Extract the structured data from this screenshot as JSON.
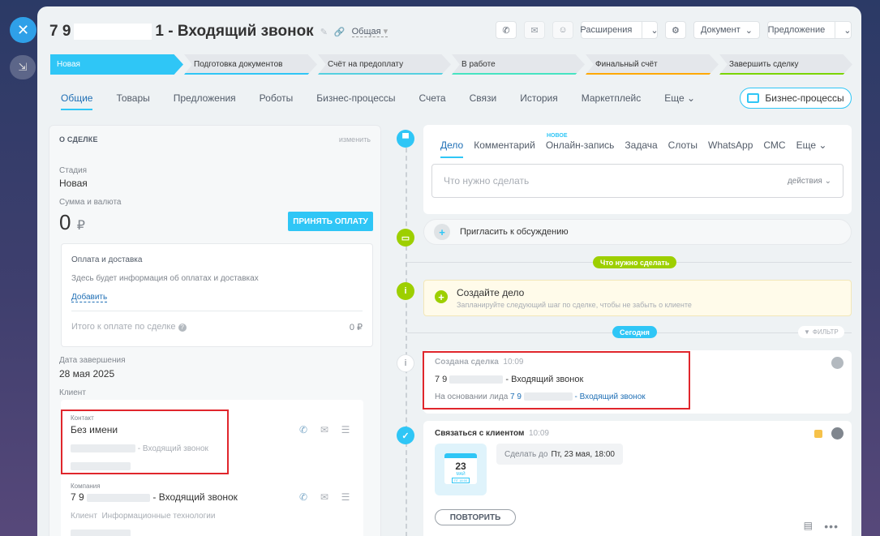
{
  "header": {
    "title_prefix": "7 9",
    "title_suffix": "1 - Входящий звонок",
    "group_label": "Общая",
    "buttons": {
      "extensions": "Расширения",
      "document": "Документ",
      "offer": "Предложение"
    },
    "icons": [
      "phone-icon",
      "mail-icon",
      "chat-icon",
      "gear-icon"
    ]
  },
  "stages": [
    {
      "label": "Новая",
      "color": "#2fc6f6"
    },
    {
      "label": "Подготовка документов",
      "color": "#2fc6f6"
    },
    {
      "label": "Счёт на предоплату",
      "color": "#55d0e0"
    },
    {
      "label": "В работе",
      "color": "#47e4c2"
    },
    {
      "label": "Финальный счёт",
      "color": "#ffa900"
    },
    {
      "label": "Завершить сделку",
      "color": "#7bd500"
    }
  ],
  "tabs": [
    "Общие",
    "Товары",
    "Предложения",
    "Роботы",
    "Бизнес-процессы",
    "Счета",
    "Связи",
    "История",
    "Маркетплейс",
    "Еще"
  ],
  "bp_button": "Бизнес-процессы",
  "about": {
    "header": "О СДЕЛКЕ",
    "edit": "изменить",
    "stage_label": "Стадия",
    "stage_value": "Новая",
    "sum_label": "Сумма и валюта",
    "sum_value": "0",
    "currency": "₽",
    "pay_button": "ПРИНЯТЬ ОПЛАТУ",
    "payment": {
      "title": "Оплата и доставка",
      "info": "Здесь будет информация об оплатах и доставках",
      "add": "Добавить",
      "total_label": "Итого к оплате по сделке",
      "total_value": "0 ₽"
    },
    "close_label": "Дата завершения",
    "close_value": "28 мая 2025",
    "client_label": "Клиент",
    "contact": {
      "label": "Контакт",
      "name": "Без имени",
      "line1_suffix": "- Входящий звонок"
    },
    "company": {
      "label": "Компания",
      "name_prefix": "7 9",
      "name_suffix": "- Входящий звонок",
      "client_type_label": "Клиент",
      "client_type_value": "Информационные технологии"
    }
  },
  "editor": {
    "tabs": [
      "Дело",
      "Комментарий",
      "Онлайн-запись",
      "Задача",
      "Слоты",
      "WhatsApp",
      "СМС",
      "Еще"
    ],
    "new_badge": "НОВОЕ",
    "placeholder": "Что нужно сделать",
    "actions": "действия"
  },
  "invite": "Пригласить к обсуждению",
  "todo_pill": "Что нужно сделать",
  "create_task": {
    "title": "Создайте дело",
    "subtitle": "Запланируйте следующий шаг по сделке, чтобы не забыть о клиенте"
  },
  "today_pill": "Сегодня",
  "filter": "ФИЛЬТР",
  "created": {
    "title": "Создана сделка",
    "time": "10:09",
    "line1_prefix": "7 9",
    "line1_suffix": "- Входящий звонок",
    "line2_prefix": "На основании лида",
    "line2_link_prefix": "7 9",
    "line2_link_suffix": "- Входящий звонок"
  },
  "contact_task": {
    "title": "Связаться с клиентом",
    "time": "10:09",
    "cal_day": "23",
    "cal_month": "МАЙ",
    "cal_time": "ПТ 18:00",
    "deadline_label": "Сделать до",
    "deadline_value": "Пт, 23 мая, 18:00",
    "repeat": "ПОВТОРИТЬ"
  }
}
